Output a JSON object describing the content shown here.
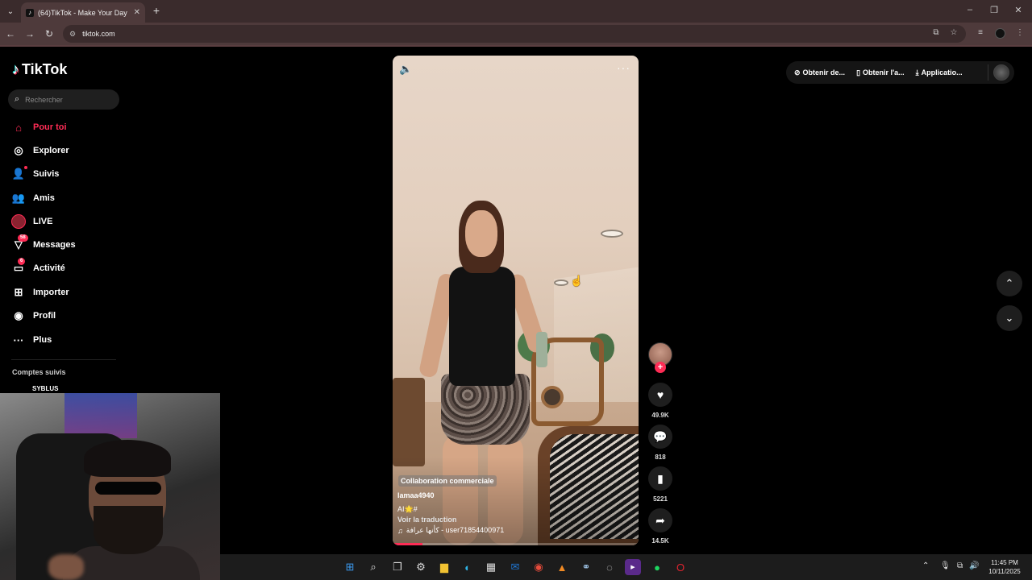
{
  "browser": {
    "tab_title": "(64)TikTok - Make Your Day",
    "url": "tiktok.com"
  },
  "sidebar": {
    "brand": "TikTok",
    "search_placeholder": "Rechercher",
    "items": [
      {
        "label": "Pour toi",
        "icon": "home-icon",
        "active": true
      },
      {
        "label": "Explorer",
        "icon": "compass-icon"
      },
      {
        "label": "Suivis",
        "icon": "following-icon"
      },
      {
        "label": "Amis",
        "icon": "friends-icon"
      },
      {
        "label": "LIVE",
        "icon": "live-icon"
      },
      {
        "label": "Messages",
        "icon": "messages-icon",
        "badge": "58"
      },
      {
        "label": "Activité",
        "icon": "activity-icon",
        "badge": "6"
      },
      {
        "label": "Importer",
        "icon": "upload-icon"
      },
      {
        "label": "Profil",
        "icon": "profile-icon"
      },
      {
        "label": "Plus",
        "icon": "more-icon"
      }
    ],
    "followed_title": "Comptes suivis",
    "followed_accounts": [
      "SYBLUS"
    ]
  },
  "video": {
    "collab_label": "Collaboration commerciale",
    "author": "lamaa4940",
    "caption": "AI🌟#",
    "translate_label": "Voir la traduction",
    "music": "كأنها عرافة - user71854400971",
    "progress": 0.12
  },
  "actions": {
    "likes": "49.9K",
    "comments": "818",
    "saves": "5221",
    "shares": "14.5K"
  },
  "header_actions": {
    "btn1": "Obtenir de...",
    "btn2": "Obtenir l'a...",
    "btn3": "Applicatio..."
  },
  "taskbar": {
    "time": "11:45 PM",
    "date": "10/11/2025"
  },
  "colors": {
    "accent": "#fe2c55",
    "chrome_frame": "#3a2b2c"
  }
}
